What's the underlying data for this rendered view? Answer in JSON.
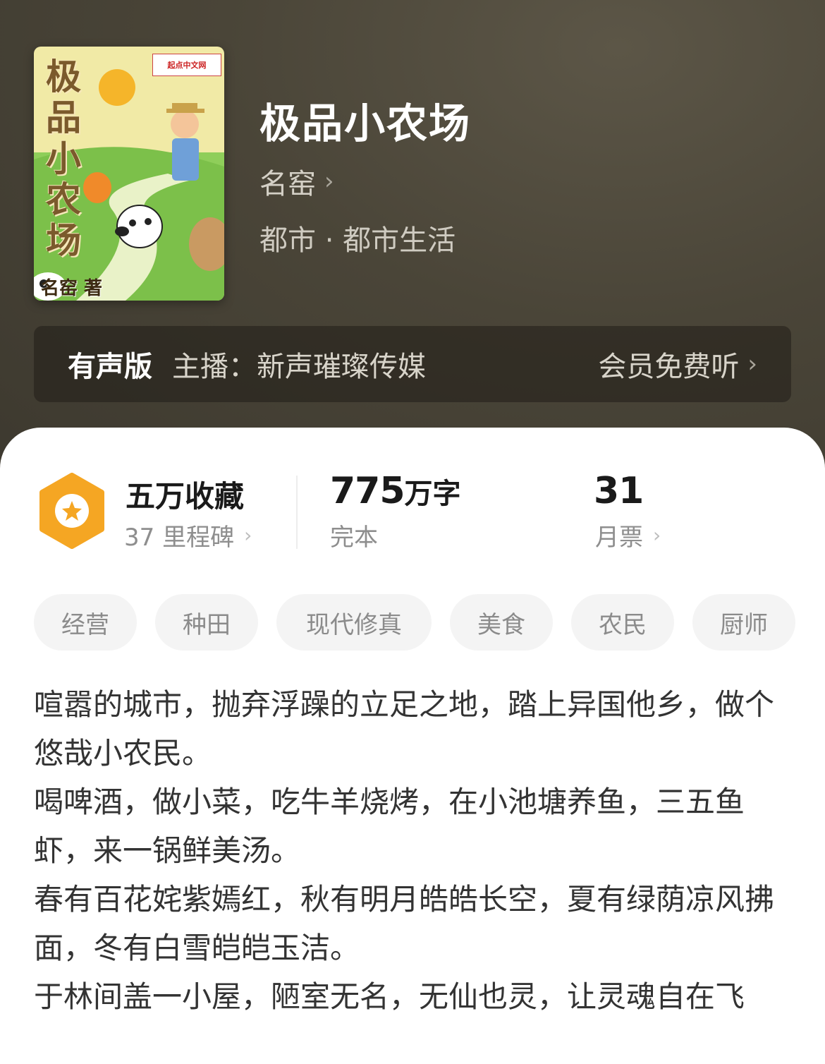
{
  "book": {
    "title": "极品小农场",
    "author": "名窑",
    "genre": "都市 · 都市生活",
    "cover": {
      "vertical_title": [
        "极",
        "品",
        "小",
        "农",
        "场"
      ],
      "author_mark": "名窑 著",
      "publisher": "起点中文网"
    }
  },
  "audio": {
    "tag": "有声版",
    "host": "主播：新声璀璨传媒",
    "cta": "会员免费听"
  },
  "stats": {
    "favorites": "五万收藏",
    "milestones": "37 里程碑",
    "word_count_number": "775",
    "word_count_unit": "万字",
    "status": "完本",
    "monthly_votes": "31",
    "monthly_votes_label": "月票"
  },
  "tags": [
    "经营",
    "种田",
    "现代修真",
    "美食",
    "农民",
    "厨师"
  ],
  "description": [
    "喧嚣的城市，抛弃浮躁的立足之地，踏上异国他乡，做个悠哉小农民。",
    "喝啤酒，做小菜，吃牛羊烧烤，在小池塘养鱼，三五鱼虾，来一锅鲜美汤。",
    "春有百花姹紫嫣红，秋有明月皓皓长空，夏有绿荫凉风拂面，冬有白雪皑皑玉洁。",
    "于林间盖一小屋，陋室无名，无仙也灵，让灵魂自在飞"
  ],
  "colors": {
    "hero_bg": "#4a4538",
    "accent_badge": "#f5a623",
    "tag_bg": "#f4f4f4"
  },
  "icons": {
    "favorite_badge": "star-hexagon-icon",
    "chevron": "chevron-right-icon"
  }
}
